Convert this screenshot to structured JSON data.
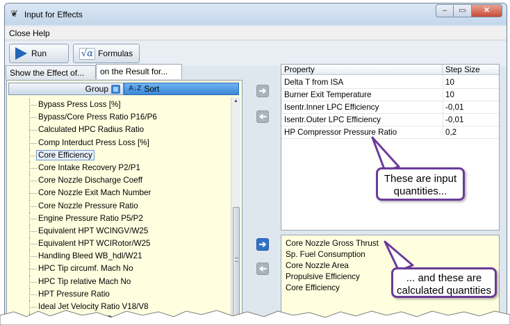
{
  "window": {
    "title": "Input for Effects",
    "buttons": {
      "minimize": "–",
      "maximize": "▭",
      "close": "✕"
    }
  },
  "menu": [
    "Close",
    "Help"
  ],
  "toolbar": {
    "run_label": "Run",
    "formulas_icon": "√α",
    "formulas_label": "Formulas"
  },
  "tabs": [
    {
      "label": "Show the Effect of...",
      "active": false
    },
    {
      "label": "on the Result for...",
      "active": true
    }
  ],
  "left_panel": {
    "group_label": "Group",
    "sort_label": "Sort",
    "sort_icon": "A↓Z",
    "items": [
      "Bypass Press Loss [%]",
      "Bypass/Core Press Ratio P16/P6",
      "Calculated HPC Radius Ratio",
      "Comp Interduct Press Loss [%]",
      "Core Efficiency",
      "Core Intake Recovery P2/P1",
      "Core Nozzle Discharge Coeff",
      "Core Nozzle Exit Mach Number",
      "Core Nozzle Pressure Ratio",
      "Engine Pressure Ratio P5/P2",
      "Equivalent HPT WCINGV/W25",
      "Equivalent HPT WCIRotor/W25",
      "Handling Bleed WB_hdl/W21",
      "HPC Tip circumf. Mach No",
      "HPC Tip relative Mach No",
      "HPT Pressure Ratio",
      "Ideal Jet Velocity Ratio V18/V8",
      "Interduct Pressure Ratio"
    ],
    "selected_index": 4
  },
  "property_table": {
    "columns": [
      "Property",
      "Step Size"
    ],
    "rows": [
      [
        "Delta T from ISA",
        "10"
      ],
      [
        "Burner Exit Temperature",
        "10"
      ],
      [
        "Isentr.Inner LPC Efficiency",
        "-0,01"
      ],
      [
        "Isentr.Outer LPC Efficiency",
        "-0,01"
      ],
      [
        "HP Compressor Pressure Ratio",
        "0,2"
      ]
    ]
  },
  "results": [
    "Core Nozzle Gross Thrust",
    "Sp. Fuel Consumption",
    "Core Nozzle Area",
    "Propulsive Efficiency",
    "Core Efficiency"
  ],
  "callouts": {
    "input": "These are input quantities...",
    "calculated": "... and these are calculated quantities"
  },
  "colors": {
    "list_background": "#ffffe0",
    "callout_border": "#6b3b98",
    "arrow_active": "#2f73c8"
  }
}
